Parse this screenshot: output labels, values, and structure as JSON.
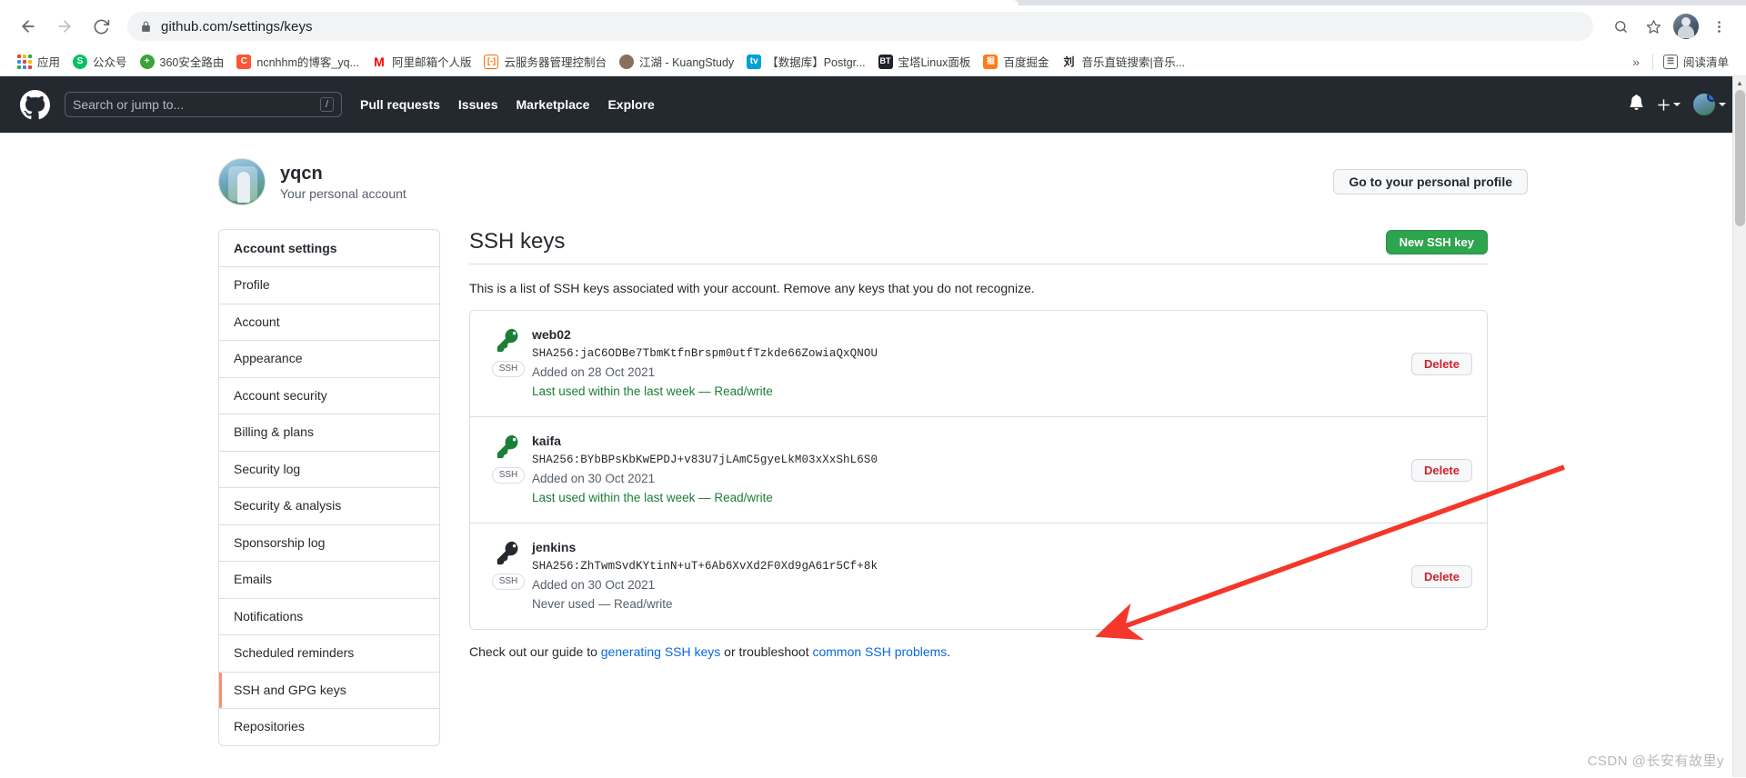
{
  "browser": {
    "back_icon": "back-arrow-icon",
    "forward_icon": "forward-arrow-icon",
    "reload_icon": "reload-icon",
    "lock_icon": "lock-icon",
    "url": "github.com/settings/keys",
    "url_domain": "github.com",
    "url_path": "/settings/keys",
    "zoom_icon": "search-zoom-icon",
    "bookmark_star_icon": "star-icon",
    "profile_icon": "browser-profile-avatar",
    "menu_icon": "three-dot-menu-icon",
    "bookmarks": [
      {
        "label": "应用",
        "icon": "apps-grid-icon",
        "color": "#4285f4"
      },
      {
        "label": "公众号",
        "icon": "wechat-official-icon",
        "color": "#07c160"
      },
      {
        "label": "360安全路由",
        "icon": "360-router-icon",
        "color": "#f5a623"
      },
      {
        "label": "ncnhhm的博客_yq...",
        "icon": "csdn-icon",
        "color": "#fc5531"
      },
      {
        "label": "阿里邮箱个人版",
        "icon": "aliyun-mail-icon",
        "color": "#ff0000"
      },
      {
        "label": "云服务器管理控制台",
        "icon": "aliyun-console-icon",
        "color": "#ff6a00"
      },
      {
        "label": "江湖 - KuangStudy",
        "icon": "kuangstudy-icon",
        "color": "#8b6f5e"
      },
      {
        "label": "【数据库】Postgr...",
        "icon": "bilibili-icon",
        "color": "#00a1d6"
      },
      {
        "label": "宝塔Linux面板",
        "icon": "bt-panel-icon",
        "color": "#20222a"
      },
      {
        "label": "百度掘金",
        "icon": "juejin-icon",
        "color": "#ff7a1a"
      },
      {
        "label": "音乐直链搜索|音乐...",
        "icon": "liu-icon",
        "color": "#222222"
      }
    ],
    "overflow_label": "»",
    "reading_list_label": "阅读清单",
    "reading_list_icon": "reading-list-icon"
  },
  "github": {
    "logo_icon": "github-mark-icon",
    "search_placeholder": "Search or jump to...",
    "search_shortcut": "/",
    "nav": [
      {
        "label": "Pull requests"
      },
      {
        "label": "Issues"
      },
      {
        "label": "Marketplace"
      },
      {
        "label": "Explore"
      }
    ],
    "notification_icon": "bell-icon",
    "create_new_icon": "plus-icon",
    "account_icon": "user-avatar-icon"
  },
  "profile": {
    "avatar_icon": "user-avatar-image",
    "name": "yqcn",
    "subtitle": "Your personal account",
    "cta_label": "Go to your personal profile"
  },
  "sidebar": {
    "heading": "Account settings",
    "items": [
      {
        "label": "Profile",
        "active": false
      },
      {
        "label": "Account",
        "active": false
      },
      {
        "label": "Appearance",
        "active": false
      },
      {
        "label": "Account security",
        "active": false
      },
      {
        "label": "Billing & plans",
        "active": false
      },
      {
        "label": "Security log",
        "active": false
      },
      {
        "label": "Security & analysis",
        "active": false
      },
      {
        "label": "Sponsorship log",
        "active": false
      },
      {
        "label": "Emails",
        "active": false
      },
      {
        "label": "Notifications",
        "active": false
      },
      {
        "label": "Scheduled reminders",
        "active": false
      },
      {
        "label": "SSH and GPG keys",
        "active": true
      },
      {
        "label": "Repositories",
        "active": false
      }
    ]
  },
  "main": {
    "title": "SSH keys",
    "new_key_label": "New SSH key",
    "intro": "This is a list of SSH keys associated with your account. Remove any keys that you do not recognize.",
    "key_icon": "key-icon",
    "key_type_badge": "SSH",
    "delete_label": "Delete",
    "keys": [
      {
        "title": "web02",
        "fingerprint": "SHA256:jaC6ODBe7TbmKtfnBrspm0utfTzkde66ZowiaQxQNOU",
        "added": "Added on 28 Oct 2021",
        "usage": "Last used within the last week — Read/write",
        "usage_state": "green"
      },
      {
        "title": "kaifa",
        "fingerprint": "SHA256:BYbBPsKbKwEPDJ+v83U7jLAmC5gyeLkM03xXxShL6S0",
        "added": "Added on 30 Oct 2021",
        "usage": "Last used within the last week — Read/write",
        "usage_state": "green"
      },
      {
        "title": "jenkins",
        "fingerprint": "SHA256:ZhTwmSvdKYtinN+uT+6Ab6XvXd2F0Xd9gA61r5Cf+8k",
        "added": "Added on 30 Oct 2021",
        "usage": "Never used — Read/write",
        "usage_state": "grey"
      }
    ],
    "footnote_prefix": "Check out our guide to ",
    "footnote_link1": "generating SSH keys",
    "footnote_middle": " or troubleshoot ",
    "footnote_link2": "common SSH problems",
    "footnote_suffix": "."
  },
  "annotation": {
    "arrow_icon": "red-arrow-annotation",
    "arrow_color": "#f4372a"
  },
  "watermark": "CSDN @长安有故里y"
}
